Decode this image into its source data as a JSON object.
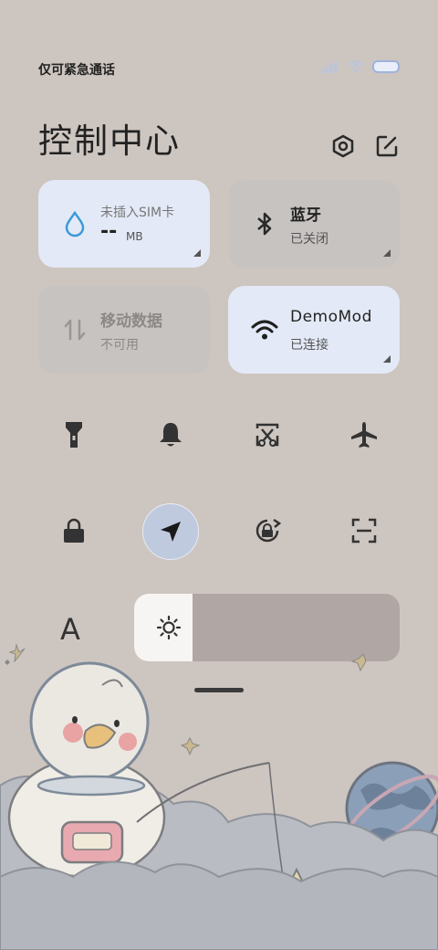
{
  "status": {
    "carrier": "仅可紧急通话"
  },
  "header": {
    "title": "控制中心"
  },
  "tiles": {
    "data_usage": {
      "title": "未插入SIM卡",
      "value": "--",
      "unit": "MB"
    },
    "bluetooth": {
      "title": "蓝牙",
      "status": "已关闭"
    },
    "mobile_data": {
      "title": "移动数据",
      "status": "不可用"
    },
    "wifi": {
      "title": "DemoMod",
      "status": "已连接"
    }
  },
  "toggles": [
    "flashlight-icon",
    "bell-icon",
    "screenshot-icon",
    "airplane-icon",
    "lock-icon",
    "location-icon",
    "rotation-lock-icon",
    "scan-icon"
  ],
  "font_label": "A",
  "brightness": {
    "level": 0.22
  },
  "colors": {
    "background": "#cdc5c0",
    "active_tile": "#e3e9f6",
    "inactive_tile": "#c7c3c1",
    "accent_blue": "#3a9ad9"
  }
}
